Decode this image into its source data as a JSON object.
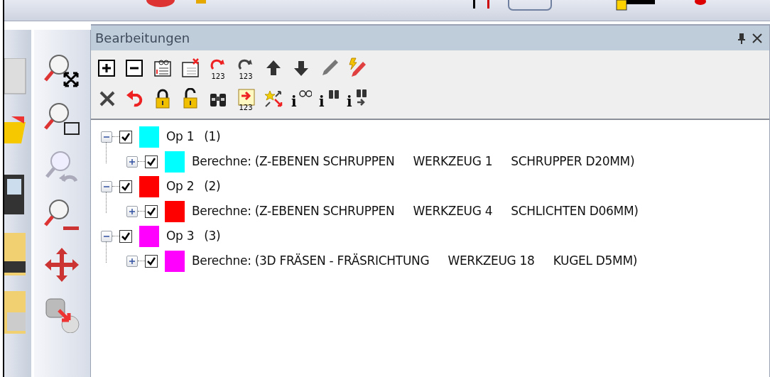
{
  "panel": {
    "title": "Bearbeitungen"
  },
  "toolbar": [
    [
      {
        "kind": "plus"
      },
      {
        "kind": "minus"
      },
      {
        "kind": "sheet-glasses"
      },
      {
        "kind": "sheet-delete"
      },
      {
        "kind": "rotate-red",
        "caption": "123"
      },
      {
        "kind": "rotate-grey",
        "caption": "123"
      },
      {
        "kind": "arrow-up"
      },
      {
        "kind": "arrow-down"
      },
      {
        "kind": "pencil"
      },
      {
        "kind": "bolt-pencil"
      }
    ],
    [
      {
        "kind": "cross"
      },
      {
        "kind": "undo"
      },
      {
        "kind": "lock"
      },
      {
        "kind": "unlock"
      },
      {
        "kind": "binoculars"
      },
      {
        "kind": "number-arrow",
        "caption": "123"
      },
      {
        "kind": "star-arrows"
      },
      {
        "kind": "info-glasses",
        "caption": "i"
      },
      {
        "kind": "info-binoculars",
        "caption": "i"
      },
      {
        "kind": "info-binoculars-arrow",
        "caption": "i"
      }
    ]
  ],
  "tree": [
    {
      "label": "Op 1",
      "count": "(1)",
      "checked": true,
      "expanded": true,
      "color": "#00ffff",
      "children": [
        {
          "texts": [
            "Berechne: (Z-EBENEN SCHRUPPEN",
            "WERKZEUG 1",
            "SCHRUPPER D20MM)"
          ],
          "checked": true,
          "expanded": false,
          "color": "#00ffff"
        }
      ]
    },
    {
      "label": "Op 2",
      "count": "(2)",
      "checked": true,
      "expanded": true,
      "color": "#ff0000",
      "children": [
        {
          "texts": [
            "Berechne: (Z-EBENEN SCHRUPPEN",
            "WERKZEUG 4",
            "SCHLICHTEN D06MM)"
          ],
          "checked": true,
          "expanded": false,
          "color": "#ff0000"
        }
      ]
    },
    {
      "label": "Op 3",
      "count": "(3)",
      "checked": true,
      "expanded": true,
      "color": "#ff00ff",
      "children": [
        {
          "texts": [
            "Berechne: (3D FRÄSEN - FRÄSRICHTUNG",
            "WERKZEUG 18",
            "KUGEL D5MM)"
          ],
          "checked": true,
          "expanded": false,
          "color": "#ff00ff"
        }
      ]
    }
  ]
}
